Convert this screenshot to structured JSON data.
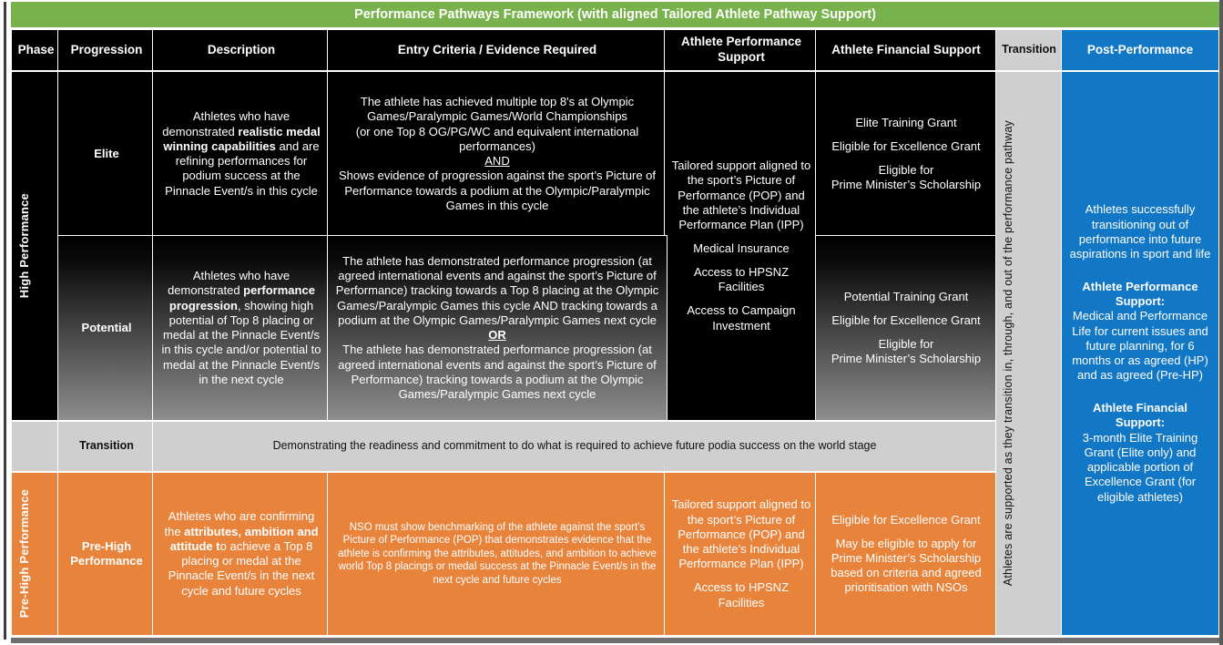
{
  "title": "Performance Pathways Framework (with aligned Tailored Athlete Pathway Support)",
  "colors": {
    "title_green": "#77B24C",
    "black": "#000000",
    "gray": "#cfcfcf",
    "orange": "#E8833C",
    "blue": "#1277C4"
  },
  "headers": {
    "phase": "Phase",
    "progression": "Progression",
    "description": "Description",
    "entry_criteria": "Entry Criteria  / Evidence Required",
    "athlete_performance_support": "Athlete Performance Support",
    "athlete_financial_support": "Athlete Financial Support",
    "transition": "Transition",
    "post_performance": "Post-Performance"
  },
  "phases": {
    "high_performance": "High Performance",
    "pre_high_performance": "Pre-High Performance"
  },
  "rows": {
    "elite": {
      "progression": "Elite",
      "description": {
        "p1": "Athletes who have demonstrated ",
        "b1": "realistic medal winning capabilities",
        "p2": " and are refining performances for podium success at the Pinnacle Event/s in this cycle"
      },
      "entry_criteria": {
        "p1": "The athlete has achieved multiple top 8's at Olympic Games/Paralympic Games/World Championships",
        "p2": "(or one Top 8 OG/PG/WC and equivalent international performances)",
        "conjunction": "AND",
        "p3": "Shows evidence of progression against the sport’s Picture of Performance towards a podium at the Olympic/Paralympic Games in this cycle"
      },
      "performance_support": "Tailored support aligned to the sport’s Picture of Performance (POP) and the athlete’s Individual Performance Plan (IPP)",
      "financial_support": {
        "l1": "Elite Training Grant",
        "l2": "Eligible for Excellence Grant",
        "l3a": "Eligible for",
        "l3b": "Prime Minister’s Scholarship"
      }
    },
    "potential": {
      "progression": "Potential",
      "description": {
        "p1": "Athletes who have demonstrated ",
        "b1": "performance progression",
        "p2": ", showing high potential of Top 8 placing or medal at the Pinnacle Event/s in this cycle and/or potential to medal at the Pinnacle Event/s in the next cycle"
      },
      "entry_criteria": {
        "p1": "The athlete has demonstrated performance progression (at agreed international events and against the sport’s Picture of Performance) tracking towards a Top 8 placing at the Olympic Games/Paralympic Games this cycle AND tracking towards a podium at the Olympic Games/Paralympic Games next cycle",
        "conjunction": "OR",
        "p2": "The athlete has demonstrated performance progression (at agreed international events and against the sport’s Picture of Performance) tracking towards a podium at the Olympic Games/Paralympic Games next cycle"
      },
      "performance_support": {
        "l1": "Medical Insurance",
        "l2": "Access to HPSNZ Facilities",
        "l3": "Access to Campaign Investment"
      },
      "financial_support": {
        "l1": "Potential Training Grant",
        "l2": "Eligible for Excellence Grant",
        "l3a": "Eligible for",
        "l3b": "Prime Minister’s Scholarship"
      }
    },
    "transition": {
      "progression": "Transition",
      "statement": "Demonstrating the readiness and commitment to do what is required to achieve future podia success on the world stage"
    },
    "pre_high_performance": {
      "progression": "Pre-High Performance",
      "description": {
        "p1": "Athletes who are confirming the ",
        "b1": "attributes, ambition and attitude",
        "b2": "t",
        "p2": "o achieve a Top 8 placing or medal at the Pinnacle Event/s in the next cycle and future cycles"
      },
      "entry_criteria": "NSO must show benchmarking of the athlete against the sport’s Picture of Performance (POP) that demonstrates evidence that the athlete is confirming the attributes, attitudes, and ambition to achieve world Top 8 placings or medal success at the Pinnacle Event/s in the next cycle and future cycles",
      "performance_support": {
        "l1": "Tailored support aligned to the sport’s Picture of Performance (POP) and the athlete’s Individual Performance Plan (IPP)",
        "l2": "Access to HPSNZ Facilities"
      },
      "financial_support": {
        "l1": "Eligible for Excellence Grant",
        "l2": "May be eligible to apply for Prime Minister’s Scholarship based on criteria and agreed prioritisation with NSOs"
      }
    }
  },
  "transition_column": {
    "text": "Athletes are supported as they transition in, through, and out of the performance pathway"
  },
  "post_performance_column": {
    "intro": "Athletes successfully transitioning out of performance into future aspirations in sport and life",
    "aps_heading": "Athlete Performance Support:",
    "aps_body": "Medical and Performance Life for current issues and future planning, for 6 months or as agreed (HP) and as agreed (Pre-HP)",
    "afs_heading": "Athlete Financial Support:",
    "afs_body": "3-month Elite Training Grant (Elite only) and applicable portion of Excellence Grant (for eligible athletes)"
  }
}
